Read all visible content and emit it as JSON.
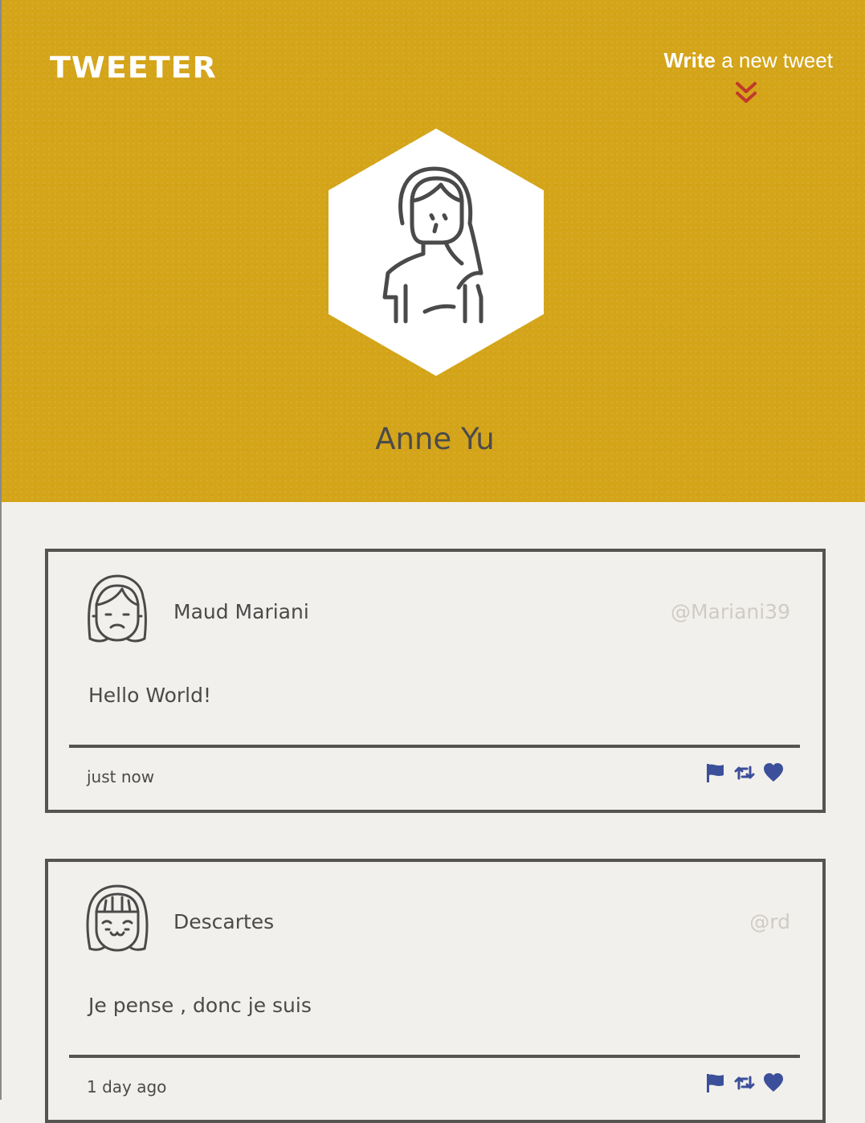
{
  "header": {
    "logo": "TWEETER",
    "compose": {
      "bold": "Write",
      "rest": " a new tweet",
      "chevron_color": "#c0392b",
      "icon": "double-chevron-down-icon"
    },
    "profile_name": "Anne Yu",
    "background": "#d4a419"
  },
  "tweets": [
    {
      "author": "Maud Mariani",
      "handle": "@Mariani39",
      "content": "Hello World!",
      "time": "just now",
      "avatar_icon": "frowning-girl-avatar-icon"
    },
    {
      "author": "Descartes",
      "handle": "@rd",
      "content": "Je pense , donc je suis",
      "time": "1 day ago",
      "avatar_icon": "smiling-bangs-avatar-icon"
    }
  ],
  "actions": {
    "icons": [
      "flag-icon",
      "retweet-icon",
      "heart-icon"
    ],
    "color": "#3b4f9a"
  }
}
